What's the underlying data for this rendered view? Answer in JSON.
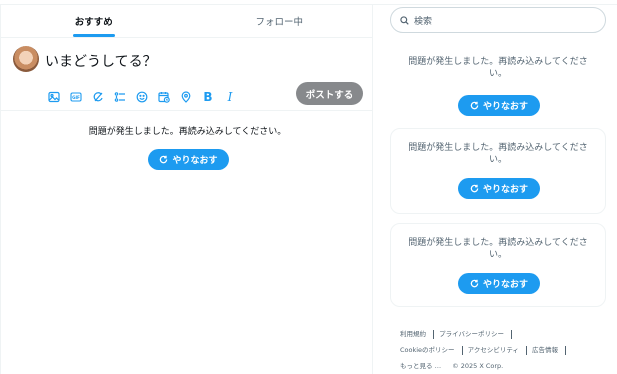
{
  "tabs": [
    {
      "label": "おすすめ",
      "active": true
    },
    {
      "label": "フォロー中",
      "active": false
    }
  ],
  "composer": {
    "placeholder": "いまどうしてる？",
    "post_label": "ポストする",
    "tools": [
      "image-icon",
      "gif-icon",
      "grok-icon",
      "poll-icon",
      "emoji-icon",
      "schedule-icon",
      "location-icon",
      "bold-icon",
      "italic-icon"
    ]
  },
  "feed": {
    "error": "問題が発生しました。再読み込みしてください。",
    "retry_label": "やりなおす"
  },
  "sidebar": {
    "search_placeholder": "検索",
    "cards": [
      {
        "text": "問題が発生しました。再読み込みしてください。",
        "retry_label": "やりなおす"
      },
      {
        "text": "問題が発生しました。再読み込みしてください。",
        "retry_label": "やりなおす"
      },
      {
        "text": "問題が発生しました。再読み込みしてください。",
        "retry_label": "やりなおす"
      }
    ],
    "footer": {
      "terms": "利用規約",
      "privacy": "プライバシーポリシー",
      "cookie": "Cookieのポリシー",
      "accessibility": "アクセシビリティ",
      "ads": "広告情報",
      "more": "もっと見る …",
      "copyright": "© 2025 X Corp."
    }
  },
  "colors": {
    "accent": "#1d9bf0",
    "post_disabled": "#87898c"
  }
}
